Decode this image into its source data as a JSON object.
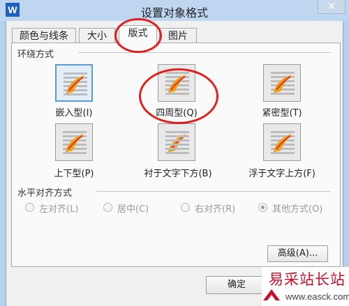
{
  "window": {
    "title": "设置对象格式",
    "app_icon": "W",
    "close_glyph": "✕"
  },
  "tabs": [
    {
      "label": "颜色与线条",
      "active": false
    },
    {
      "label": "大小",
      "active": false
    },
    {
      "label": "版式",
      "active": true
    },
    {
      "label": "图片",
      "active": false
    }
  ],
  "wrap_section": {
    "label": "环绕方式",
    "options": [
      {
        "label": "嵌入型(I)",
        "icon": "inline-wrap-icon",
        "selected": true
      },
      {
        "label": "四周型(Q)",
        "icon": "square-wrap-icon",
        "selected": false
      },
      {
        "label": "紧密型(T)",
        "icon": "tight-wrap-icon",
        "selected": false
      },
      {
        "label": "上下型(P)",
        "icon": "top-bottom-wrap-icon",
        "selected": false
      },
      {
        "label": "衬于文字下方(B)",
        "icon": "behind-text-icon",
        "selected": false
      },
      {
        "label": "浮于文字上方(F)",
        "icon": "in-front-text-icon",
        "selected": false
      }
    ]
  },
  "align_section": {
    "label": "水平对齐方式",
    "options": [
      {
        "label": "左对齐(L)",
        "checked": false
      },
      {
        "label": "居中(C)",
        "checked": false
      },
      {
        "label": "右对齐(R)",
        "checked": false
      },
      {
        "label": "其他方式(O)",
        "checked": true
      }
    ]
  },
  "buttons": {
    "advanced": "高级(A)...",
    "ok": "确定"
  },
  "watermark": {
    "text": "易采站长站",
    "url": "www.easck.com"
  },
  "colors": {
    "annotation": "#e01f1f",
    "selection": "#5b9bd5",
    "feather": "#f0a020"
  }
}
